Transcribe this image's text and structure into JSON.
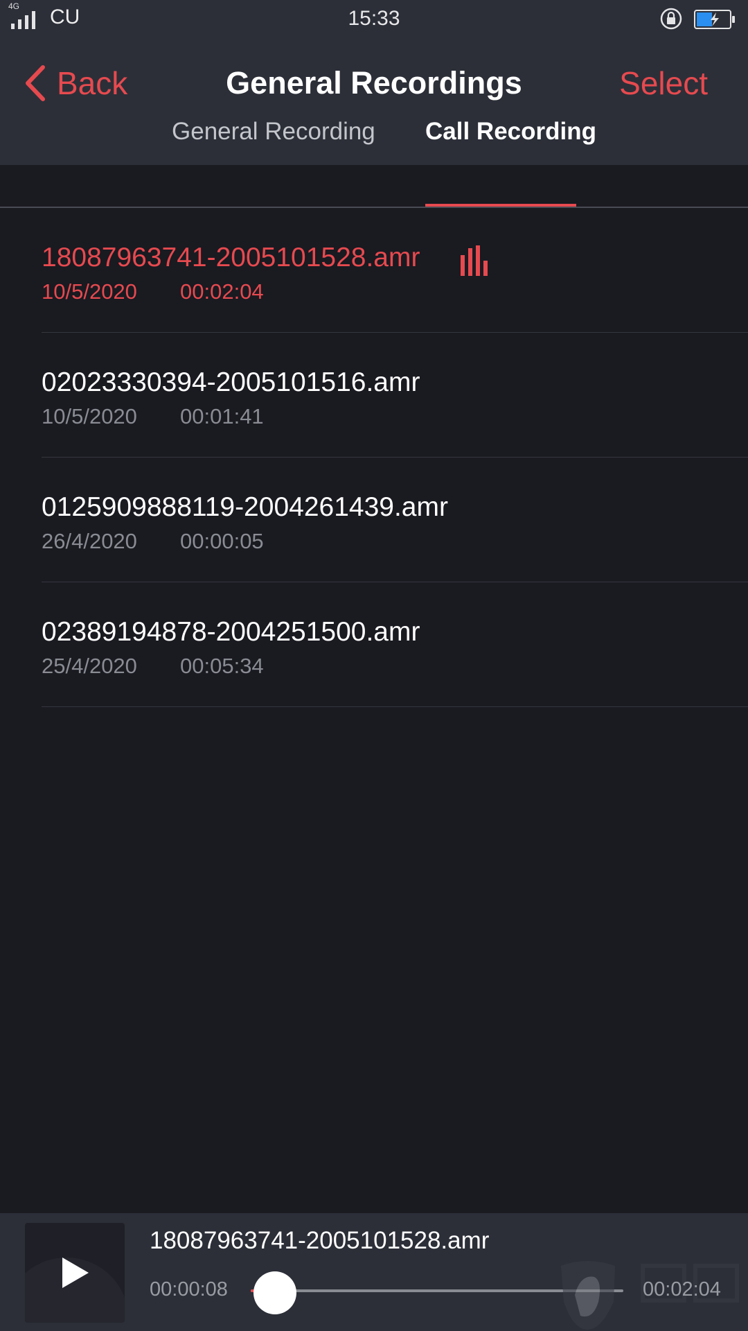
{
  "status_bar": {
    "network": "4G",
    "carrier": "CU",
    "time": "15:33"
  },
  "header": {
    "back_label": "Back",
    "title": "General Recordings",
    "select_label": "Select"
  },
  "tabs": [
    {
      "label": "General Recording",
      "selected": false
    },
    {
      "label": "Call Recording",
      "selected": true
    }
  ],
  "recordings": [
    {
      "name": "18087963741-2005101528.amr",
      "date": "10/5/2020",
      "duration": "00:02:04",
      "playing": true
    },
    {
      "name": "02023330394-2005101516.amr",
      "date": "10/5/2020",
      "duration": "00:01:41",
      "playing": false
    },
    {
      "name": "0125909888119-2004261439.amr",
      "date": "26/4/2020",
      "duration": "00:00:05",
      "playing": false
    },
    {
      "name": "02389194878-2004251500.amr",
      "date": "25/4/2020",
      "duration": "00:05:34",
      "playing": false
    }
  ],
  "player": {
    "name": "18087963741-2005101528.amr",
    "current_time": "00:00:08",
    "total_time": "00:02:04",
    "progress": 0.065
  },
  "colors": {
    "accent": "#e64a4f",
    "background": "#1a1a21",
    "bar": "#2c2f38",
    "battery": "#2a8ff0"
  }
}
